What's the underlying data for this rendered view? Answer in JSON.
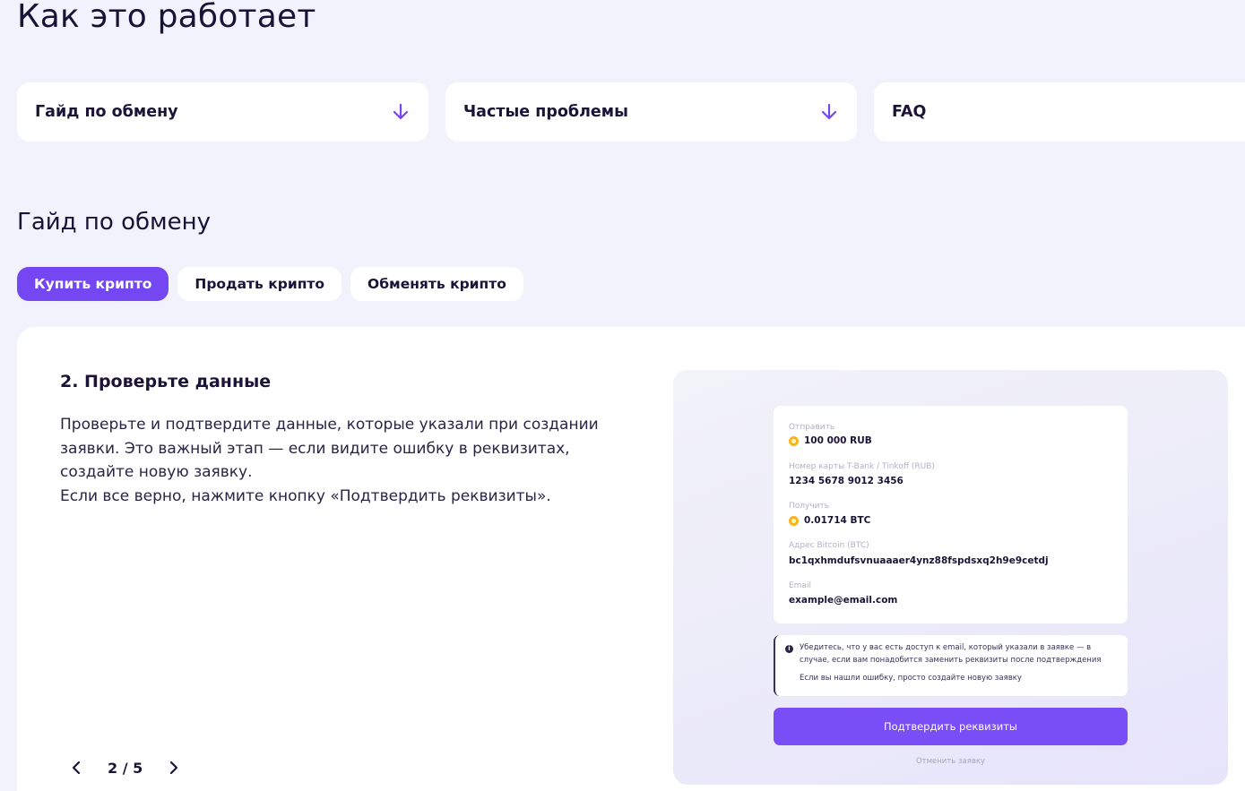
{
  "page": {
    "title": "Как это работает"
  },
  "accordions": [
    {
      "label": "Гайд по обмену",
      "icon": "arrow-down-icon"
    },
    {
      "label": "Частые проблемы",
      "icon": "arrow-down-icon"
    },
    {
      "label": "FAQ"
    }
  ],
  "section": {
    "title": "Гайд по обмену"
  },
  "tabs": [
    {
      "label": "Купить крипто",
      "active": true
    },
    {
      "label": "Продать крипто",
      "active": false
    },
    {
      "label": "Обменять крипто",
      "active": false
    }
  ],
  "step": {
    "title": "2. Проверьте данные",
    "body_line1": "Проверьте и подтвердите данные, которые указали при создании заявки. Это важный этап — если видите ошибку в реквизитах, создайте новую заявку.",
    "body_line2": "Если все верно, нажмите кнопку «Подтвердить реквизиты»."
  },
  "pager": {
    "text": "2 / 5",
    "current": 2,
    "total": 5
  },
  "preview": {
    "fields": [
      {
        "label": "Отправить",
        "value": "100 000 RUB",
        "coin": "rub-coin-icon"
      },
      {
        "label": "Номер карты T-Bank / Tinkoff (RUB)",
        "value": "1234 5678 9012 3456"
      },
      {
        "label": "Получить",
        "value": "0.01714 BTC",
        "coin": "btc-coin-icon"
      },
      {
        "label": "Адрес Bitcoin (BTC)",
        "value": "bc1qxhmdufsvnuaaaer4ynz88fspdsxq2h9e9cetdj"
      },
      {
        "label": "Email",
        "value": "example@email.com"
      }
    ],
    "notice_line1": "Убедитесь, что у вас есть доступ к email, который указали в заявке — в случае, если вам понадобится заменить реквизиты после подтверждения",
    "notice_line2": "Если вы нашли ошибку, просто создайте новую заявку",
    "confirm_label": "Подтвердить реквизиты",
    "cancel_label": "Отменить заявку"
  },
  "colors": {
    "accent": "#7447f2",
    "background": "#f1f2fb",
    "text": "#1c1438",
    "coin": "#f5b51d"
  }
}
